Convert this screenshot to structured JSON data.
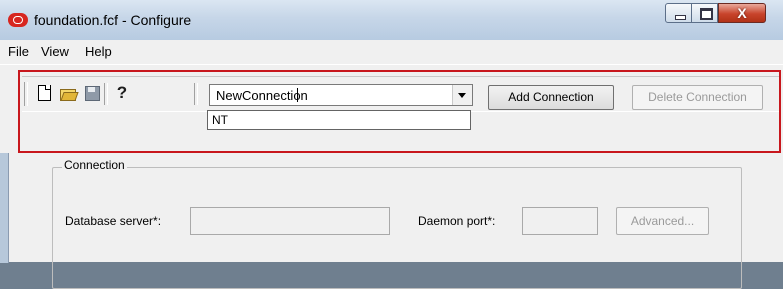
{
  "window": {
    "title": "foundation.fcf - Configure"
  },
  "title_controls": {
    "close_glyph": "X"
  },
  "menubar": {
    "items": [
      "File",
      "View",
      "Help"
    ]
  },
  "toolbar": {
    "help_glyph": "?",
    "connection_combo": {
      "value": "NewConnection"
    },
    "dropdown_items": [
      "NT"
    ],
    "add_connection_label": "Add Connection",
    "delete_connection_label": "Delete Connection"
  },
  "connection_group": {
    "title": "Connection",
    "database_server_label": "Database server*:",
    "database_server_value": "",
    "daemon_port_label": "Daemon port*:",
    "daemon_port_value": "",
    "advanced_label": "Advanced..."
  },
  "colors": {
    "highlight_border": "#c8171d",
    "oracle_red": "#d7261f"
  }
}
